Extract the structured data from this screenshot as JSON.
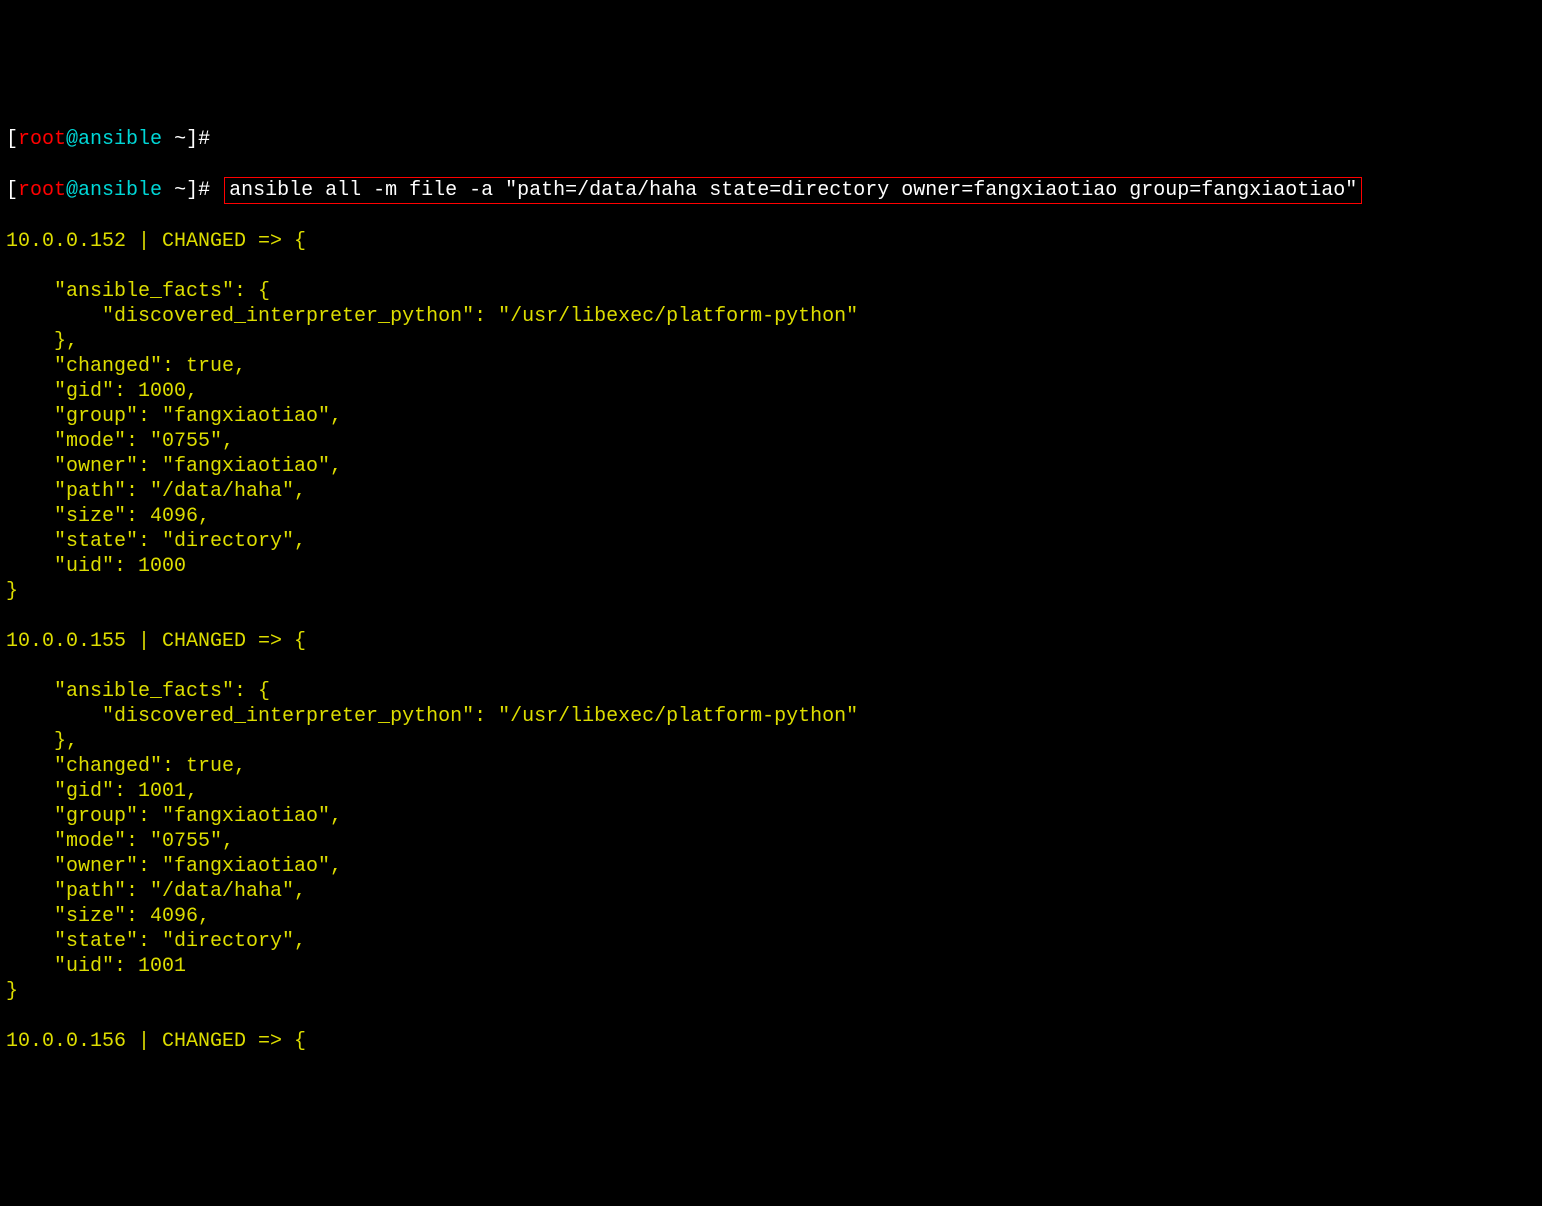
{
  "prompt": {
    "open": "[",
    "user": "root",
    "at": "@",
    "host": "ansible",
    "path": " ~",
    "close": "]",
    "hash": "# "
  },
  "command": "ansible all -m file -a \"path=/data/haha state=directory owner=fangxiaotiao group=fangxiaotiao\"",
  "output": {
    "host1_header": "10.0.0.152 | CHANGED => {",
    "host1_body": "    \"ansible_facts\": {\n        \"discovered_interpreter_python\": \"/usr/libexec/platform-python\"\n    },\n    \"changed\": true,\n    \"gid\": 1000,\n    \"group\": \"fangxiaotiao\",\n    \"mode\": \"0755\",\n    \"owner\": \"fangxiaotiao\",\n    \"path\": \"/data/haha\",\n    \"size\": 4096,\n    \"state\": \"directory\",\n    \"uid\": 1000\n}",
    "host2_header": "10.0.0.155 | CHANGED => {",
    "host2_body": "    \"ansible_facts\": {\n        \"discovered_interpreter_python\": \"/usr/libexec/platform-python\"\n    },\n    \"changed\": true,\n    \"gid\": 1001,\n    \"group\": \"fangxiaotiao\",\n    \"mode\": \"0755\",\n    \"owner\": \"fangxiaotiao\",\n    \"path\": \"/data/haha\",\n    \"size\": 4096,\n    \"state\": \"directory\",\n    \"uid\": 1001\n}",
    "host3_header": "10.0.0.156 | CHANGED => {"
  }
}
